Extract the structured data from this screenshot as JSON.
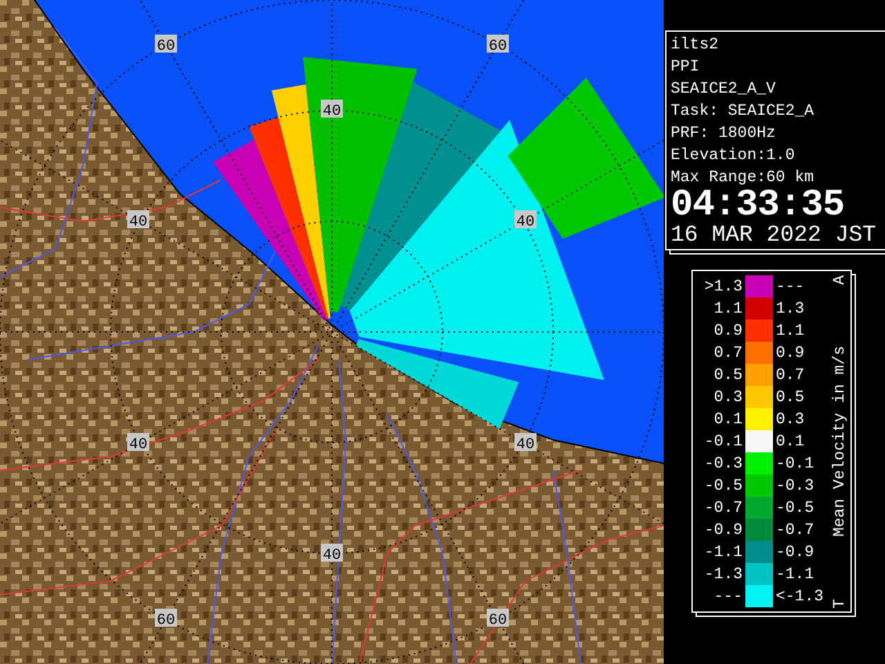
{
  "map": {
    "range_labels": [
      "60",
      "60",
      "40",
      "40",
      "40",
      "40",
      "40",
      "40",
      "60",
      "60"
    ]
  },
  "info": {
    "lines": [
      "ilts2",
      "PPI",
      "SEAICE2_A_V",
      "Task: SEAICE2_A",
      "PRF: 1800Hz",
      "Elevation:1.0",
      "Max Range:60 km"
    ],
    "time": "04:33:35",
    "date": "16 MAR 2022 JST"
  },
  "legend": {
    "title": "Mean Velocity in m/s",
    "top_mark": "A",
    "bottom_mark": "T",
    "rows": [
      {
        "low": ">1.3",
        "high": "---",
        "color": "#c800b4"
      },
      {
        "low": "1.1",
        "high": "1.3",
        "color": "#d00000"
      },
      {
        "low": "0.9",
        "high": "1.1",
        "color": "#ff3000"
      },
      {
        "low": "0.7",
        "high": "0.9",
        "color": "#ff7000"
      },
      {
        "low": "0.5",
        "high": "0.7",
        "color": "#ffa000"
      },
      {
        "low": "0.3",
        "high": "0.5",
        "color": "#ffc800"
      },
      {
        "low": "0.1",
        "high": "0.3",
        "color": "#fff000"
      },
      {
        "low": "-0.1",
        "high": "0.1",
        "color": "#f8f8f8"
      },
      {
        "low": "-0.3",
        "high": "-0.1",
        "color": "#00f000"
      },
      {
        "low": "-0.5",
        "high": "-0.3",
        "color": "#00c800"
      },
      {
        "low": "-0.7",
        "high": "-0.5",
        "color": "#00a830"
      },
      {
        "low": "-0.9",
        "high": "-0.7",
        "color": "#008a3c"
      },
      {
        "low": "-1.1",
        "high": "-0.9",
        "color": "#008c8c"
      },
      {
        "low": "-1.3",
        "high": "-1.1",
        "color": "#00c4c4"
      },
      {
        "low": "---",
        "high": "<-1.3",
        "color": "#00f4f4"
      }
    ]
  }
}
